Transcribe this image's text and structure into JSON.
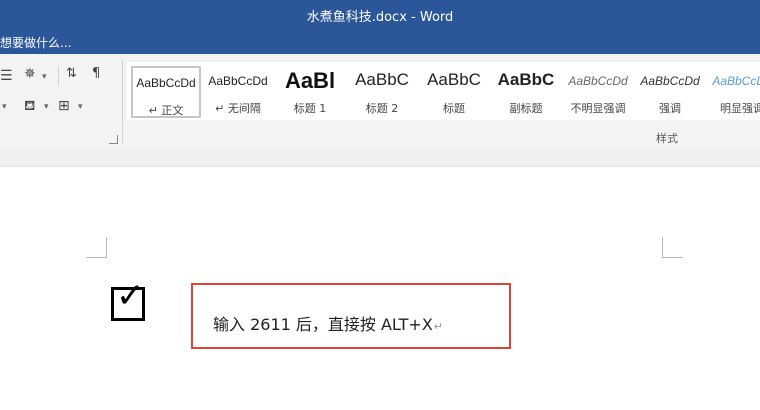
{
  "window": {
    "title": "水煮鱼科技.docx - Word"
  },
  "tell_me": {
    "text": "想要做什么..."
  },
  "ribbon": {
    "group_label": "样式",
    "styles": [
      {
        "preview": "AaBbCcDd",
        "label": "↵ 正文",
        "size": 12,
        "bold": false,
        "italic": false,
        "color": "#222222",
        "selected": true
      },
      {
        "preview": "AaBbCcDd",
        "label": "↵ 无间隔",
        "size": 12,
        "bold": false,
        "italic": false,
        "color": "#222222",
        "selected": false
      },
      {
        "preview": "AaBl",
        "label": "标题 1",
        "size": 22,
        "bold": true,
        "italic": false,
        "color": "#111111",
        "selected": false
      },
      {
        "preview": "AaBbC",
        "label": "标题 2",
        "size": 17,
        "bold": false,
        "italic": false,
        "color": "#222222",
        "selected": false
      },
      {
        "preview": "AaBbC",
        "label": "标题",
        "size": 17,
        "bold": false,
        "italic": false,
        "color": "#222222",
        "selected": false
      },
      {
        "preview": "AaBbC",
        "label": "副标题",
        "size": 17,
        "bold": true,
        "italic": false,
        "color": "#222222",
        "selected": false
      },
      {
        "preview": "AaBbCcDd",
        "label": "不明显强调",
        "size": 12,
        "bold": false,
        "italic": true,
        "color": "#666666",
        "selected": false
      },
      {
        "preview": "AaBbCcDd",
        "label": "强调",
        "size": 12,
        "bold": false,
        "italic": true,
        "color": "#333333",
        "selected": false
      },
      {
        "preview": "AaBbCcDd",
        "label": "明显强调",
        "size": 12,
        "bold": false,
        "italic": true,
        "color": "#5b9bd5",
        "selected": false
      }
    ]
  },
  "document": {
    "checkbox_symbol": "✓",
    "annotation_text": "输入 2611 后，直接按 ALT+X",
    "paragraph_mark": "↵"
  },
  "colors": {
    "titlebar": "#2b579a",
    "annotation_border": "#d9453b"
  }
}
